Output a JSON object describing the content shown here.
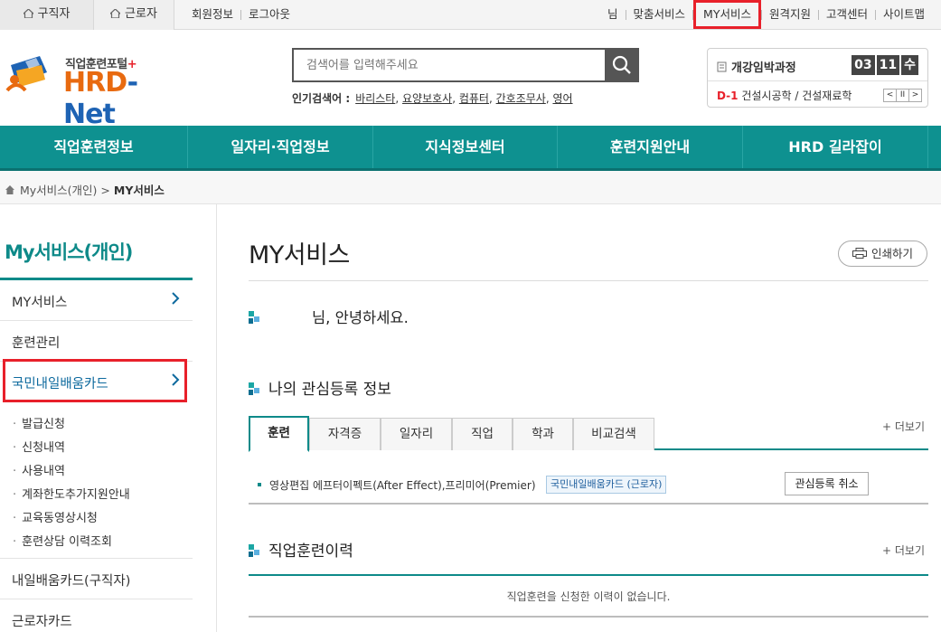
{
  "topbar": {
    "tabs": [
      {
        "label": "구직자"
      },
      {
        "label": "근로자"
      }
    ],
    "left_links": [
      "회원정보",
      "로그아웃"
    ],
    "user_suffix": "님",
    "right_links": [
      "맞춤서비스",
      "MY서비스",
      "원격지원",
      "고객센터",
      "사이트맵"
    ],
    "highlighted_link": "MY서비스"
  },
  "logo": {
    "subtitle": "직업훈련포털",
    "plus": "+",
    "hrd": "HRD",
    "dash_net": "-Net"
  },
  "search": {
    "placeholder": "검색어를 입력해주세요",
    "popular_label": "인기검색어 :",
    "popular_terms": [
      "바리스타",
      "요양보호사",
      "컴퓨터",
      "간호조무사",
      "영어"
    ]
  },
  "course_box": {
    "title": "개강임박과정",
    "date": [
      "03",
      "11",
      "수"
    ],
    "dday": "D-1",
    "course": "건설시공학 / 건설재료학",
    "controls": [
      "<",
      "II",
      ">"
    ]
  },
  "gnb": [
    "직업훈련정보",
    "일자리·직업정보",
    "지식정보센터",
    "훈련지원안내",
    "HRD 길라잡이"
  ],
  "breadcrumb": {
    "home": "My서비스(개인)",
    "sep": ">",
    "current": "MY서비스"
  },
  "sidebar": {
    "title": "My서비스(개인)",
    "items": [
      {
        "label": "MY서비스",
        "arrow": true
      },
      {
        "label": "훈련관리",
        "arrow": false
      },
      {
        "label": "국민내일배움카드",
        "arrow": true
      }
    ],
    "subitems": [
      "발급신청",
      "신청내역",
      "사용내역",
      "계좌한도추가지원안내",
      "교육동영상시청",
      "훈련상담 이력조회"
    ],
    "bottom_items": [
      {
        "label": "내일배움카드(구직자)"
      },
      {
        "label": "근로자카드"
      }
    ]
  },
  "content": {
    "title": "MY서비스",
    "print_label": "인쇄하기",
    "welcome": "님, 안녕하세요.",
    "interest": {
      "heading": "나의 관심등록 정보",
      "more": "+ 더보기",
      "tabs": [
        "훈련",
        "자격증",
        "일자리",
        "직업",
        "학과",
        "비교검색"
      ],
      "active_tab": "훈련",
      "item_text": "영상편집 에프터이펙트(After Effect),프리미어(Premier)",
      "item_tag": "국민내일배움카드 (근로자)",
      "cancel_label": "관심등록 취소"
    },
    "history": {
      "heading": "직업훈련이력",
      "more": "+ 더보기",
      "empty": "직업훈련을 신청한 이력이 없습니다."
    }
  },
  "colors": {
    "teal": "#0e9190",
    "highlight_red": "#e8202a",
    "logo_orange": "#e86a10",
    "logo_blue": "#1e63b4"
  }
}
